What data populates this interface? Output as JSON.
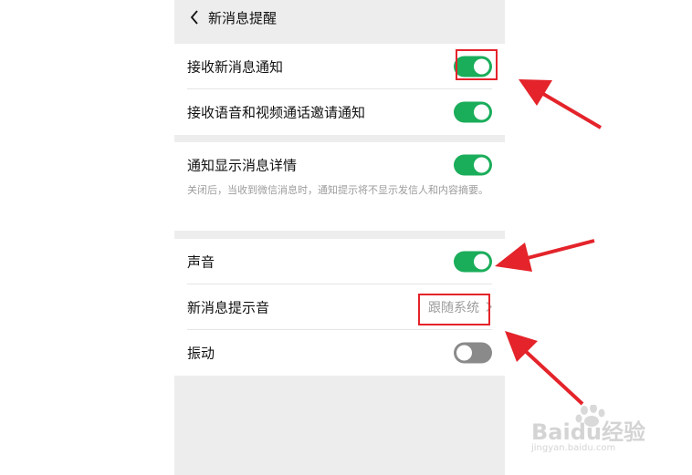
{
  "header": {
    "title": "新消息提醒"
  },
  "group1": {
    "receive_new_message": {
      "label": "接收新消息通知",
      "enabled": true
    },
    "receive_call_invite": {
      "label": "接收语音和视频通话邀请通知",
      "enabled": true
    }
  },
  "group2": {
    "show_details": {
      "label": "通知显示消息详情",
      "enabled": true
    },
    "description": "关闭后，当收到微信消息时，通知提示将不显示发信人和内容摘要。"
  },
  "group3": {
    "sound": {
      "label": "声音",
      "enabled": true
    },
    "ringtone": {
      "label": "新消息提示音",
      "value": "跟随系统"
    },
    "vibrate": {
      "label": "振动",
      "enabled": false
    }
  },
  "watermark": {
    "brand": "Baidu经验",
    "url": "jingyan.baidu.com"
  },
  "colors": {
    "accent": "#1aad5a",
    "annotation": "#e4232a",
    "background": "#ededed"
  }
}
